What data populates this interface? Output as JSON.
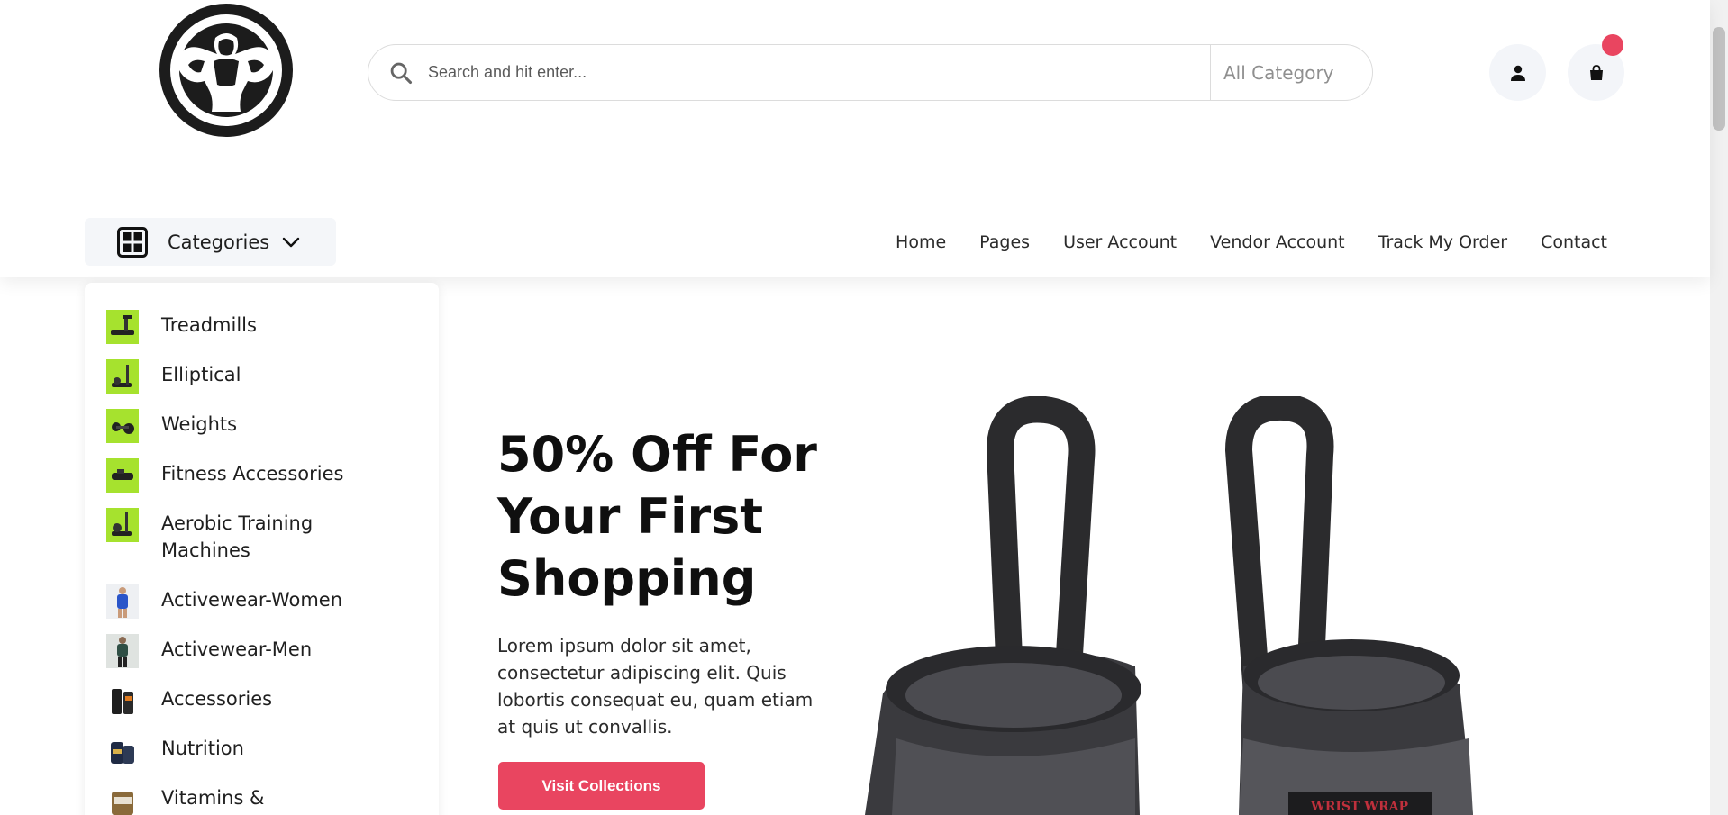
{
  "header": {
    "search": {
      "placeholder": "Search and hit enter...",
      "category_label": "All Category"
    },
    "cart_badge": "",
    "categories_label": "Categories"
  },
  "nav": {
    "items": [
      {
        "label": "Home"
      },
      {
        "label": "Pages"
      },
      {
        "label": "User Account"
      },
      {
        "label": "Vendor Account"
      },
      {
        "label": "Track My Order"
      },
      {
        "label": "Contact"
      }
    ]
  },
  "sidebar": {
    "items": [
      {
        "label": "Treadmills"
      },
      {
        "label": "Elliptical"
      },
      {
        "label": "Weights"
      },
      {
        "label": "Fitness Accessories"
      },
      {
        "label": "Aerobic Training Machines"
      },
      {
        "label": "Activewear-Women"
      },
      {
        "label": "Activewear-Men"
      },
      {
        "label": "Accessories"
      },
      {
        "label": "Nutrition"
      },
      {
        "label": "Vitamins & Supplements"
      }
    ]
  },
  "hero": {
    "title": "50% Off For Your First Shopping",
    "description": "Lorem ipsum dolor sit amet, consectetur adipiscing elit. Quis lobortis consequat eu, quam etiam at quis ut convallis.",
    "button_label": "Visit Collections",
    "product_text": "WRIST WRAP"
  },
  "colors": {
    "accent": "#e94560",
    "thumb_green": "#a6e22e",
    "icon_bg": "#f3f5f9"
  },
  "icons": {
    "logo": "bodybuilder-logo",
    "search": "search-icon",
    "user": "user-icon",
    "cart": "shopping-bag-icon",
    "categories": "grid-icon",
    "chevron": "chevron-down-icon"
  }
}
